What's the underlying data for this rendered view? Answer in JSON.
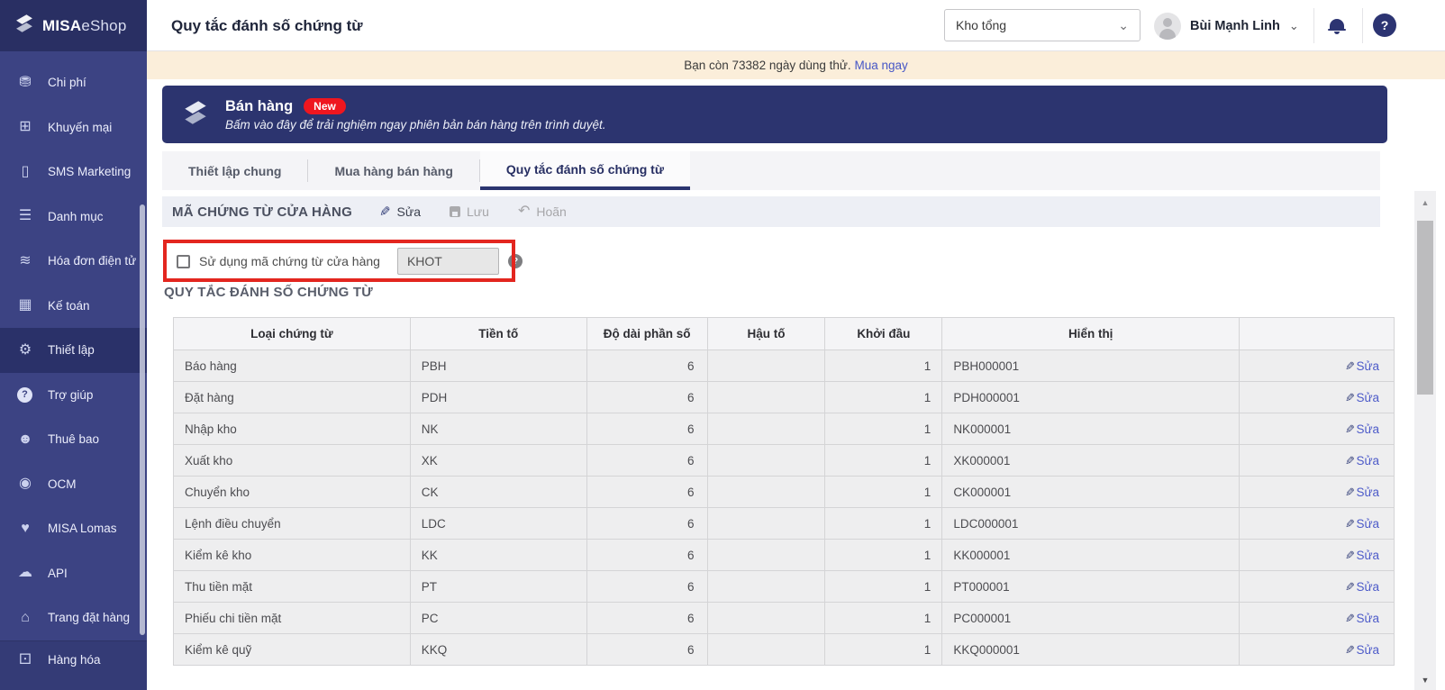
{
  "app": {
    "brand_bold": "MISA",
    "brand_light": "eShop"
  },
  "sidebar": {
    "items": [
      {
        "key": "chi-phi",
        "label": "Chi phí",
        "icon": "money-bag-icon"
      },
      {
        "key": "khuyen-mai",
        "label": "Khuyến mại",
        "icon": "gift-icon"
      },
      {
        "key": "sms-marketing",
        "label": "SMS Marketing",
        "icon": "phone-icon"
      },
      {
        "key": "danh-muc",
        "label": "Danh mục",
        "icon": "list-icon"
      },
      {
        "key": "hoa-don-dien-tu",
        "label": "Hóa đơn điện tử",
        "icon": "e-invoice-icon"
      },
      {
        "key": "ke-toan",
        "label": "Kế toán",
        "icon": "calculator-icon"
      },
      {
        "key": "thiet-lap",
        "label": "Thiết lập",
        "icon": "gear-icon",
        "active": true
      },
      {
        "key": "tro-giup",
        "label": "Trợ giúp",
        "icon": "help-circle-icon"
      },
      {
        "key": "thue-bao",
        "label": "Thuê bao",
        "icon": "user-circle-icon"
      },
      {
        "key": "ocm",
        "label": "OCM",
        "icon": "ocm-swirl-icon"
      },
      {
        "key": "misa-lomas",
        "label": "MISA Lomas",
        "icon": "layered-hearts-icon"
      },
      {
        "key": "api",
        "label": "API",
        "icon": "cloud-upload-icon"
      },
      {
        "key": "trang-dat-hang",
        "label": "Trang đặt hàng",
        "icon": "order-basket-icon"
      },
      {
        "key": "hang-hoa",
        "label": "Hàng hóa",
        "icon": "goods-cubes-icon",
        "bottom": true
      }
    ]
  },
  "header": {
    "title": "Quy tắc đánh số chứng từ",
    "branch_selector": {
      "value": "Kho tổng"
    },
    "user": {
      "name": "Bùi Mạnh Linh"
    },
    "help_label": "?"
  },
  "trial_banner": {
    "text": "Bạn còn 73382 ngày dùng thử.",
    "link_label": "Mua ngay"
  },
  "promo_banner": {
    "title": "Bán hàng",
    "badge": "New",
    "subtitle": "Bấm vào đây để trải nghiệm ngay phiên bản bán hàng trên trình duyệt."
  },
  "tabs": {
    "items": [
      {
        "key": "thiet-lap-chung",
        "label": "Thiết lập chung",
        "active": false
      },
      {
        "key": "mua-hang-ban-hang",
        "label": "Mua hàng bán hàng",
        "active": false
      },
      {
        "key": "quy-tac-danh-so-chung-tu",
        "label": "Quy tắc đánh số chứng từ",
        "active": true
      }
    ]
  },
  "store_code_section": {
    "title": "MÃ CHỨNG TỪ CỬA HÀNG",
    "actions": {
      "edit": "Sửa",
      "save": "Lưu",
      "cancel": "Hoãn"
    },
    "checkbox_label": "Sử dụng mã chứng từ cửa hàng",
    "checkbox_checked": false,
    "code_value": "KHOT"
  },
  "numbering_section": {
    "title": "QUY TẮC ĐÁNH SỐ CHỨNG TỪ",
    "table": {
      "columns": [
        "Loại chứng từ",
        "Tiền tố",
        "Độ dài phần số",
        "Hậu tố",
        "Khởi đầu",
        "Hiển thị",
        ""
      ],
      "edit_label": "Sửa",
      "rows": [
        {
          "type": "Báo hàng",
          "prefix": "PBH",
          "number_length": "6",
          "suffix": "",
          "start": "1",
          "display": "PBH000001"
        },
        {
          "type": "Đặt hàng",
          "prefix": "PDH",
          "number_length": "6",
          "suffix": "",
          "start": "1",
          "display": "PDH000001"
        },
        {
          "type": "Nhập kho",
          "prefix": "NK",
          "number_length": "6",
          "suffix": "",
          "start": "1",
          "display": "NK000001"
        },
        {
          "type": "Xuất kho",
          "prefix": "XK",
          "number_length": "6",
          "suffix": "",
          "start": "1",
          "display": "XK000001"
        },
        {
          "type": "Chuyển kho",
          "prefix": "CK",
          "number_length": "6",
          "suffix": "",
          "start": "1",
          "display": "CK000001"
        },
        {
          "type": "Lệnh điều chuyển",
          "prefix": "LDC",
          "number_length": "6",
          "suffix": "",
          "start": "1",
          "display": "LDC000001"
        },
        {
          "type": "Kiểm kê kho",
          "prefix": "KK",
          "number_length": "6",
          "suffix": "",
          "start": "1",
          "display": "KK000001"
        },
        {
          "type": "Thu tiền mặt",
          "prefix": "PT",
          "number_length": "6",
          "suffix": "",
          "start": "1",
          "display": "PT000001"
        },
        {
          "type": "Phiếu chi tiền mặt",
          "prefix": "PC",
          "number_length": "6",
          "suffix": "",
          "start": "1",
          "display": "PC000001"
        },
        {
          "type": "Kiểm kê quỹ",
          "prefix": "KKQ",
          "number_length": "6",
          "suffix": "",
          "start": "1",
          "display": "KKQ000001"
        }
      ]
    }
  },
  "colors": {
    "accent_navy": "#2c346f",
    "sidebar_navy": "#3c4383",
    "annotation_red": "#e3261f",
    "badge_red": "#ef161f",
    "link_blue": "#4d5bc9",
    "trial_bg": "#fbeeda"
  }
}
